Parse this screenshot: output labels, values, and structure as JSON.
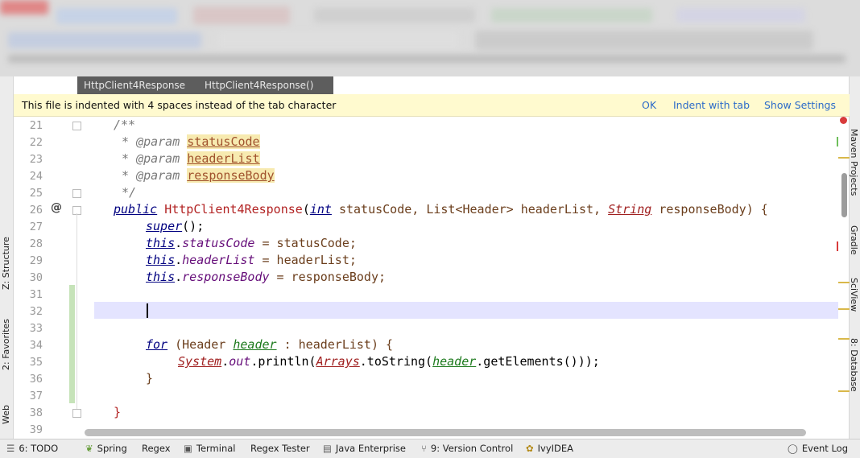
{
  "breadcrumb": [
    "HttpClient4Response",
    "HttpClient4Response()"
  ],
  "notification": {
    "message": "This file is indented with 4 spaces instead of the tab character",
    "ok": "OK",
    "indent": "Indent with tab",
    "settings": "Show Settings"
  },
  "left_tools": [
    "Z: Structure",
    "2: Favorites",
    "Web"
  ],
  "right_tools": [
    "Maven Projects",
    "Gradle",
    "SciView",
    "8: Database"
  ],
  "editor": {
    "line_numbers": [
      "21",
      "22",
      "23",
      "24",
      "25",
      "26",
      "27",
      "28",
      "29",
      "30",
      "31",
      "32",
      "33",
      "34",
      "35",
      "36",
      "37",
      "38",
      "39"
    ],
    "current_line": "32"
  },
  "code": {
    "l21": "/**",
    "l22_star": "* ",
    "l22_tag": "@param ",
    "l22_p": "statusCode",
    "l23_star": "* ",
    "l23_tag": "@param ",
    "l23_p": "headerList",
    "l24_star": "* ",
    "l24_tag": "@param ",
    "l24_p": "responseBody",
    "l25": "*/",
    "l26_public": "public",
    "l26_name": " HttpClient4Response",
    "l26_open": "(",
    "l26_int": "int",
    "l26_a": " statusCode, List<Header> headerList, ",
    "l26_String": "String",
    "l26_b": " responseBody) {",
    "l27_super": "super",
    "l27_rest": "();",
    "l28_this": "this",
    "l28_dot": ".",
    "l28_f": "statusCode",
    "l28_rest": " = statusCode;",
    "l29_this": "this",
    "l29_dot": ".",
    "l29_f": "headerList",
    "l29_rest": " = headerList;",
    "l30_this": "this",
    "l30_dot": ".",
    "l30_f": "responseBody",
    "l30_rest": " = responseBody;",
    "l34_for": "for",
    "l34_a": " (Header ",
    "l34_h": "header",
    "l34_b": " : headerList) {",
    "l35_sys": "System",
    "l35_dot": ".",
    "l35_out": "out",
    "l35_a": ".println(",
    "l35_arr": "Arrays",
    "l35_b": ".toString(",
    "l35_h": "header",
    "l35_c": ".getElements()));",
    "l36": "}",
    "l38": "}"
  },
  "bottom_bar": [
    {
      "icon": "todo-icon",
      "label": "6: TODO"
    },
    {
      "icon": "spring-icon",
      "label": "Spring"
    },
    {
      "icon": "",
      "label": "Regex"
    },
    {
      "icon": "terminal-icon",
      "label": "Terminal"
    },
    {
      "icon": "",
      "label": "Regex Tester"
    },
    {
      "icon": "java-enterprise-icon",
      "label": "Java Enterprise"
    },
    {
      "icon": "vcs-icon",
      "label": "9: Version Control"
    },
    {
      "icon": "ivy-icon",
      "label": "IvyIDEA"
    },
    {
      "icon": "event-log-icon",
      "label": "Event Log"
    }
  ],
  "colors": {
    "notice_bg": "#fffacf",
    "link": "#2c6bc9",
    "keyword": "#000080",
    "current_line": "#e4e4ff",
    "changed": "#c6e3b9"
  }
}
